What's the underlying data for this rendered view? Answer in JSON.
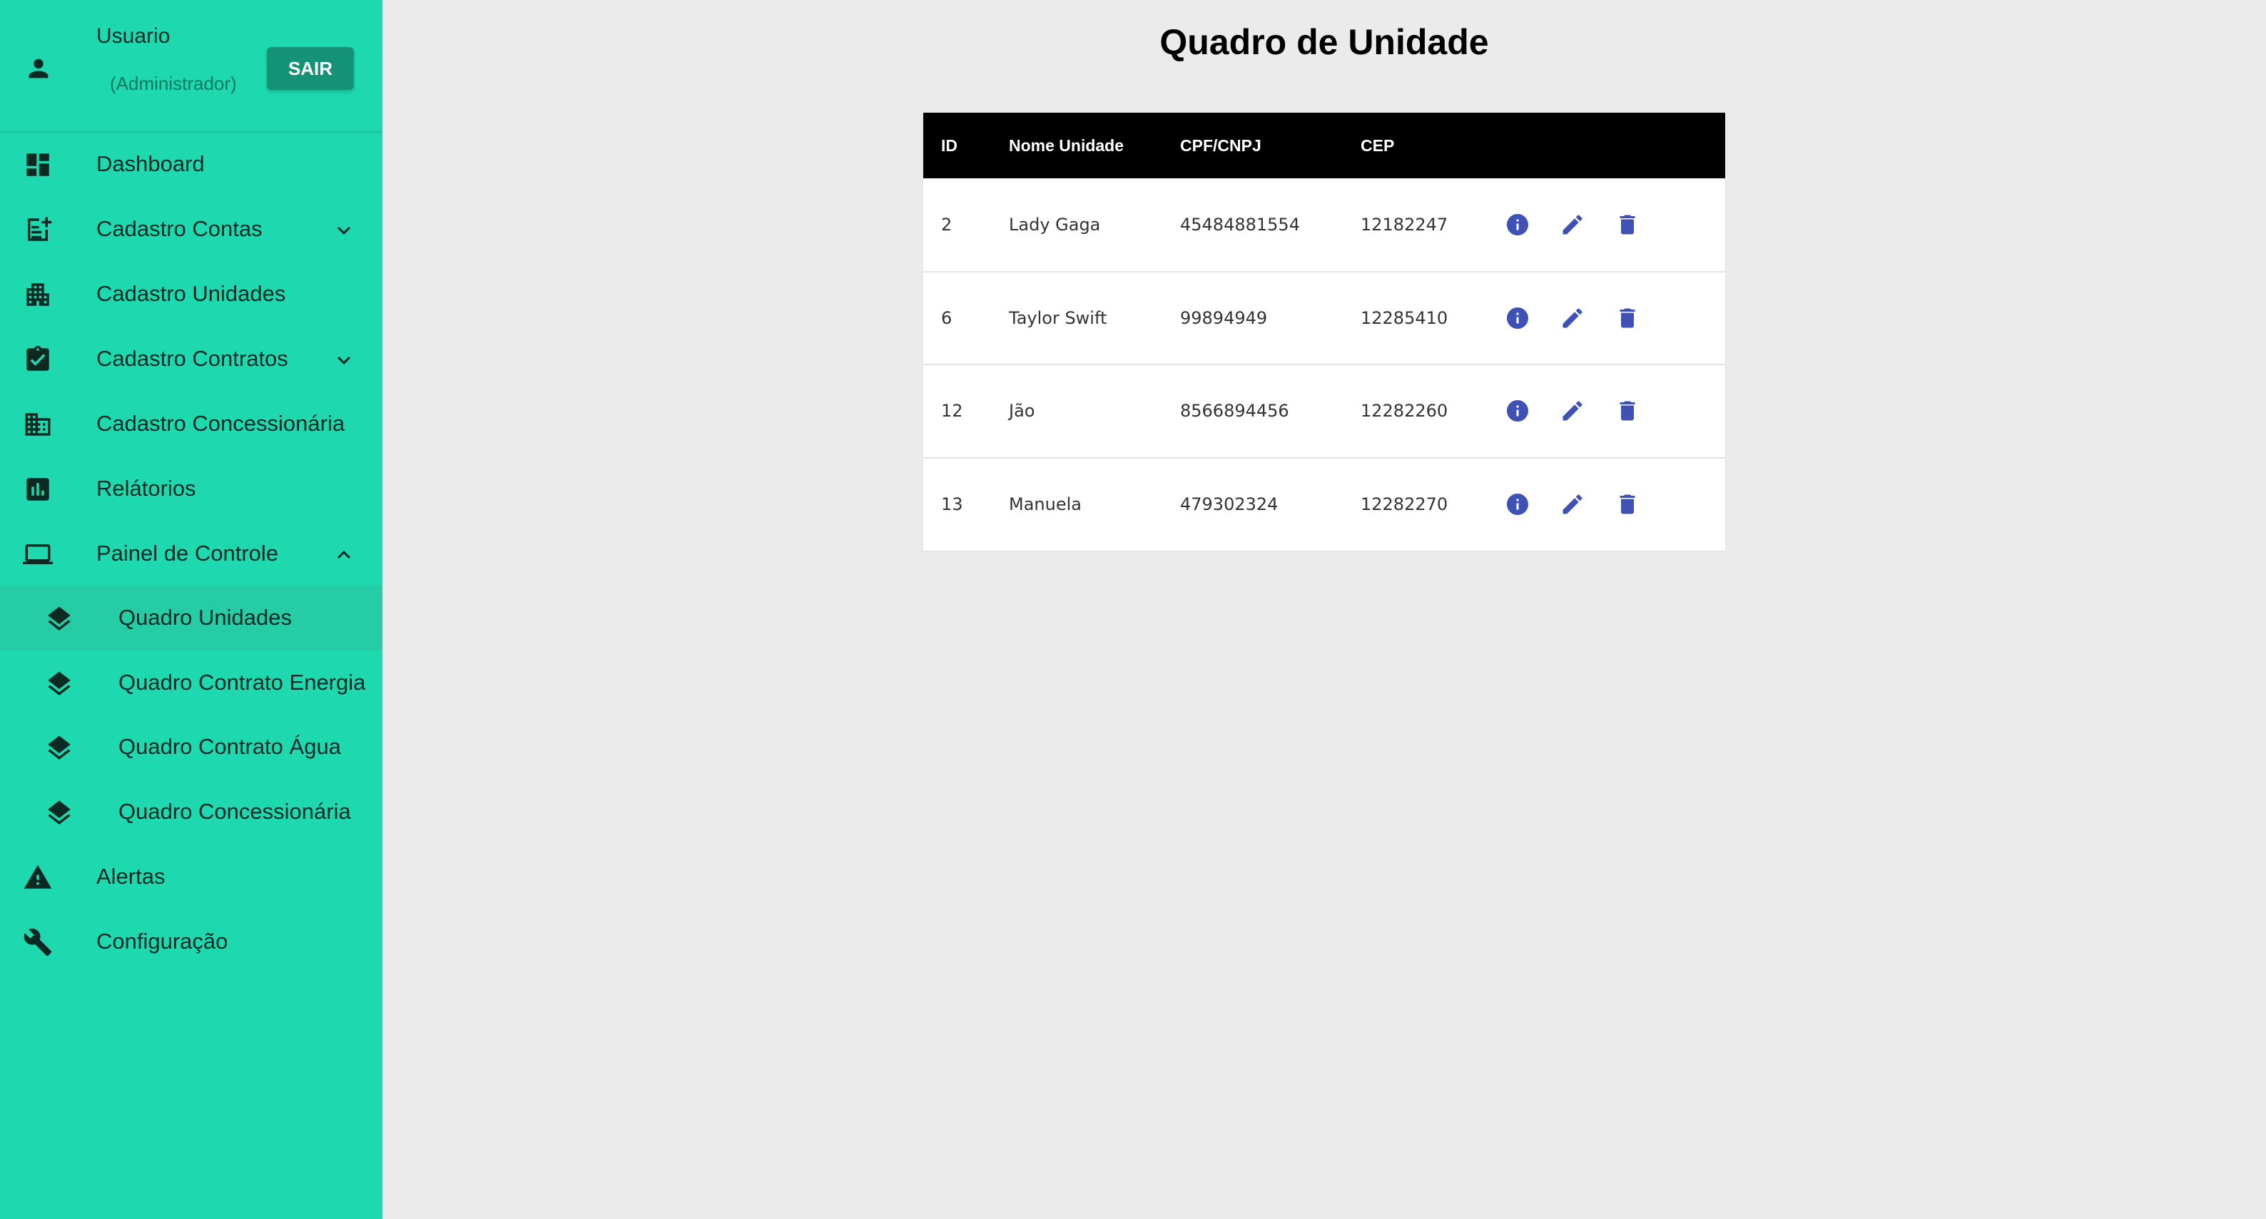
{
  "user": {
    "name": "Usuario",
    "role": "(Administrador)",
    "logout_label": "SAIR"
  },
  "sidebar": {
    "items": [
      {
        "label": "Dashboard",
        "icon": "dashboard-icon"
      },
      {
        "label": "Cadastro Contas",
        "icon": "note-add-icon",
        "expandable": true,
        "expanded": false
      },
      {
        "label": "Cadastro Unidades",
        "icon": "apartment-icon"
      },
      {
        "label": "Cadastro Contratos",
        "icon": "assignment-check-icon",
        "expandable": true,
        "expanded": false
      },
      {
        "label": "Cadastro Concessionária",
        "icon": "business-icon"
      },
      {
        "label": "Relátorios",
        "icon": "assessment-icon"
      },
      {
        "label": "Painel de Controle",
        "icon": "laptop-icon",
        "expandable": true,
        "expanded": true
      },
      {
        "label": "Alertas",
        "icon": "warning-icon"
      },
      {
        "label": "Configuração",
        "icon": "wrench-icon"
      }
    ],
    "subitems": [
      {
        "label": "Quadro Unidades",
        "icon": "layers-icon",
        "active": true
      },
      {
        "label": "Quadro Contrato Energia",
        "icon": "layers-icon"
      },
      {
        "label": "Quadro Contrato Água",
        "icon": "layers-icon"
      },
      {
        "label": "Quadro Concessionária",
        "icon": "layers-icon"
      }
    ]
  },
  "main": {
    "title": "Quadro de Unidade",
    "table": {
      "columns": [
        "ID",
        "Nome Unidade",
        "CPF/CNPJ",
        "CEP",
        ""
      ],
      "rows": [
        [
          "2",
          "Lady Gaga",
          "45484881554",
          "12182247"
        ],
        [
          "6",
          "Taylor Swift",
          "99894949",
          "12285410"
        ],
        [
          "12",
          "Jão",
          "8566894456",
          "12282260"
        ],
        [
          "13",
          "Manuela",
          "479302324",
          "12282270"
        ]
      ],
      "row_actions": [
        "info-icon",
        "edit-icon",
        "delete-icon"
      ]
    }
  },
  "colors": {
    "sidebar_bg": "#1ed9b0",
    "active_item_bg": "#26cca6",
    "logout_button_bg": "#149377",
    "table_header_bg": "#000000",
    "action_icon": "#3f51b5",
    "page_bg": "#ebebeb"
  }
}
